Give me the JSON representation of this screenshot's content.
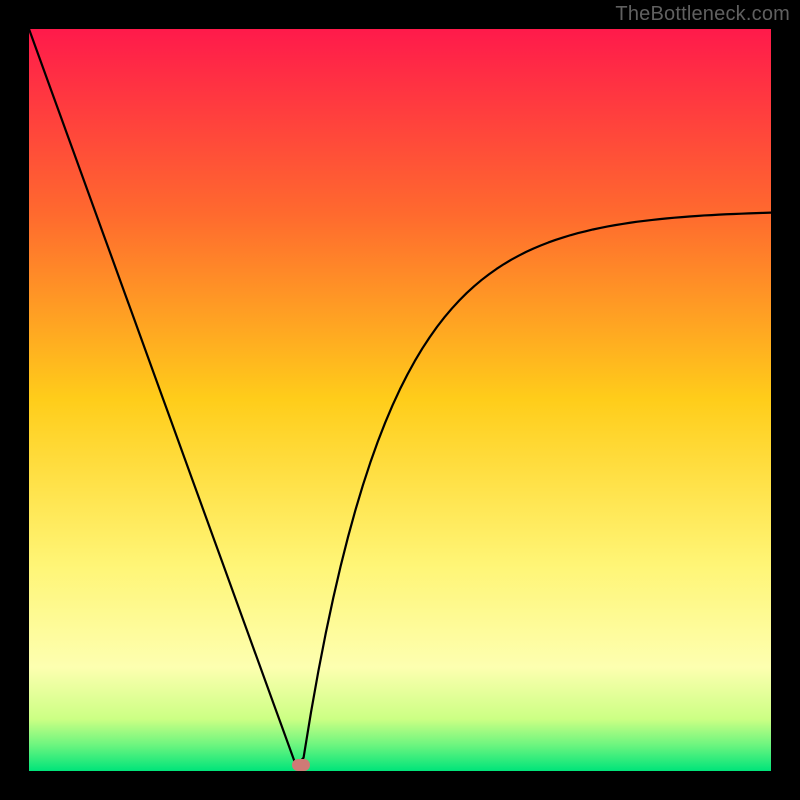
{
  "watermark": "TheBottleneck.com",
  "chart_data": {
    "type": "line",
    "title": "",
    "xlabel": "",
    "ylabel": "",
    "xlim": [
      0,
      100
    ],
    "ylim": [
      0,
      100
    ],
    "x": [
      0,
      1,
      2,
      3,
      4,
      5,
      6,
      7,
      8,
      9,
      10,
      11,
      12,
      13,
      14,
      15,
      16,
      17,
      18,
      19,
      20,
      21,
      22,
      23,
      24,
      25,
      26,
      27,
      28,
      29,
      30,
      31,
      32,
      33,
      34,
      35,
      36,
      37,
      38,
      39,
      40,
      41,
      42,
      43,
      44,
      45,
      46,
      47,
      48,
      49,
      50,
      51,
      52,
      53,
      54,
      55,
      56,
      57,
      58,
      59,
      60,
      61,
      62,
      63,
      64,
      65,
      66,
      67,
      68,
      69,
      70,
      71,
      72,
      73,
      74,
      75,
      76,
      77,
      78,
      79,
      80,
      81,
      82,
      83,
      84,
      85,
      86,
      87,
      88,
      89,
      90,
      91,
      92,
      93,
      94,
      95,
      96,
      97,
      98,
      99,
      100
    ],
    "values": [
      100,
      97.24,
      94.48,
      91.72,
      88.97,
      86.21,
      83.45,
      80.69,
      77.93,
      75.17,
      72.41,
      69.66,
      66.9,
      64.14,
      61.38,
      58.62,
      55.86,
      53.1,
      50.34,
      47.59,
      44.83,
      42.07,
      39.31,
      36.55,
      33.79,
      31.03,
      28.28,
      25.52,
      22.76,
      20,
      17.24,
      14.48,
      11.72,
      8.97,
      6.21,
      3.45,
      0.69,
      1.78,
      7.88,
      13.47,
      18.6,
      23.3,
      27.61,
      31.56,
      35.19,
      38.52,
      41.57,
      44.37,
      46.94,
      49.3,
      51.46,
      53.44,
      55.26,
      56.93,
      58.46,
      59.87,
      61.16,
      62.34,
      63.43,
      64.43,
      65.34,
      66.18,
      66.95,
      67.66,
      68.31,
      68.91,
      69.45,
      69.96,
      70.42,
      70.84,
      71.23,
      71.59,
      71.91,
      72.22,
      72.49,
      72.74,
      72.98,
      73.19,
      73.39,
      73.57,
      73.73,
      73.89,
      74.03,
      74.15,
      74.27,
      74.38,
      74.48,
      74.57,
      74.65,
      74.73,
      74.8,
      74.87,
      74.92,
      74.98,
      75.03,
      75.07,
      75.11,
      75.15,
      75.19,
      75.22,
      75.25
    ],
    "marker": {
      "x": 36.7,
      "y": 0.8
    },
    "gradient_stops": [
      {
        "offset": 0.0,
        "color": "#ff1a4b"
      },
      {
        "offset": 0.25,
        "color": "#ff6a2e"
      },
      {
        "offset": 0.5,
        "color": "#ffcd1a"
      },
      {
        "offset": 0.72,
        "color": "#fff575"
      },
      {
        "offset": 0.86,
        "color": "#fdffb0"
      },
      {
        "offset": 0.93,
        "color": "#ccff84"
      },
      {
        "offset": 0.965,
        "color": "#6cf57f"
      },
      {
        "offset": 1.0,
        "color": "#00e47a"
      }
    ]
  }
}
